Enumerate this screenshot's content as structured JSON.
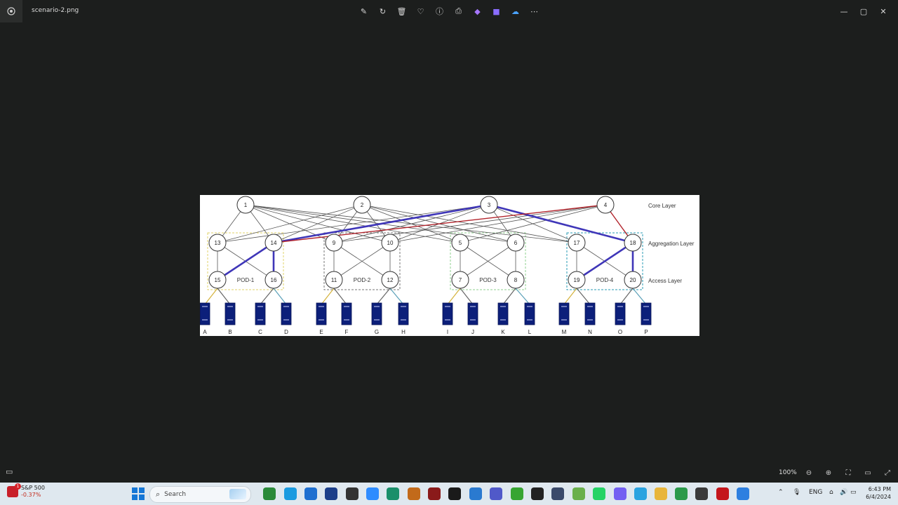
{
  "window": {
    "file_name": "scenario-2.png",
    "toolbar_icons": [
      "edit-icon",
      "rotate-icon",
      "delete-icon",
      "favorite-icon",
      "info-icon",
      "print-icon",
      "clipchamp-icon",
      "edit-video-icon",
      "onedrive-icon",
      "more-icon"
    ],
    "controls": {
      "minimize": "—",
      "maximize": "▢",
      "close": "✕"
    }
  },
  "diagram": {
    "layers": {
      "core": "Core Layer",
      "aggregation": "Aggregation Layer",
      "access": "Access Layer"
    },
    "nodes": {
      "core": [
        "1",
        "2",
        "3",
        "4"
      ],
      "aggregation": [
        "13",
        "14",
        "9",
        "10",
        "5",
        "6",
        "17",
        "18"
      ],
      "access": [
        "15",
        "16",
        "11",
        "12",
        "7",
        "8",
        "19",
        "20"
      ]
    },
    "pods": [
      "POD-1",
      "POD-2",
      "POD-3",
      "POD-4"
    ],
    "servers": [
      "A",
      "B",
      "C",
      "D",
      "E",
      "F",
      "G",
      "H",
      "I",
      "J",
      "K",
      "L",
      "M",
      "N",
      "O",
      "P"
    ],
    "highlight_colors": {
      "blue_path": "#3f36b8",
      "red_path": "#b2242c"
    }
  },
  "status": {
    "zoom": "100%"
  },
  "taskbar": {
    "ticker_name": "S&P 500",
    "ticker_change": "-0.37%",
    "ticker_badge": "1",
    "search_placeholder": "Search",
    "tray_lang": "ENG",
    "time": "6:43 PM",
    "date": "6/4/2024"
  }
}
